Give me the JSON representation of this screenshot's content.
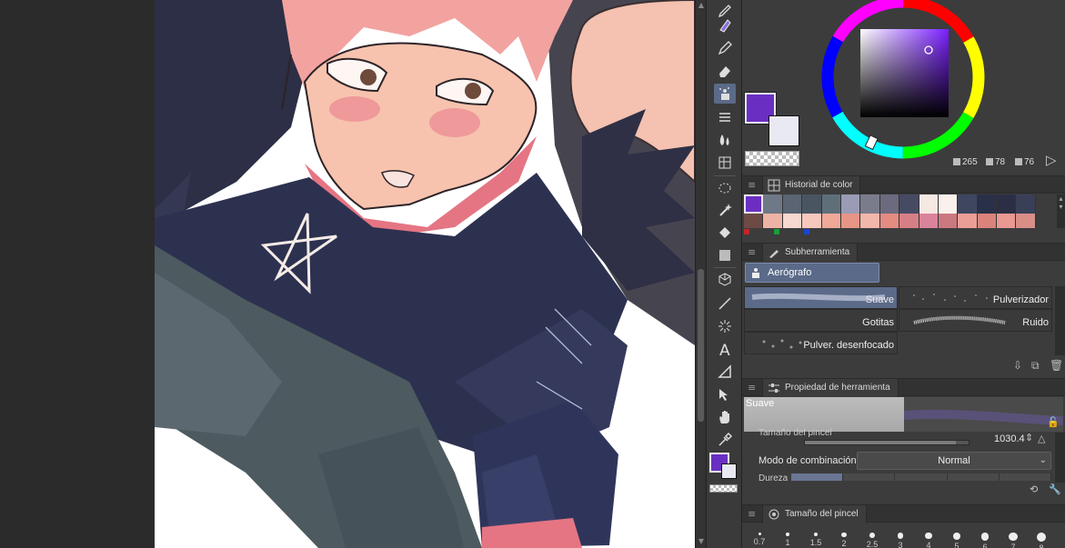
{
  "color": {
    "main_color": "#6a2fc2",
    "sub_color": "#e9e9f4",
    "h": "265",
    "s": "78",
    "v": "76",
    "h_icon": "hue-icon",
    "s_icon": "saturation-icon",
    "v_icon": "value-icon"
  },
  "panels": {
    "history_title": "Historial de color",
    "subtool_title": "Subherramienta",
    "property_title": "Propiedad de herramienta",
    "brushsize_title": "Tamaño del pincel"
  },
  "history": {
    "row1": [
      "#6a2fc2",
      "#6f7886",
      "#5a6472",
      "#4a5562",
      "#5f6f7a",
      "#9a9cb6",
      "#7a7c8c",
      "#6b6a7e",
      "#474a63",
      "#f6e8e2",
      "#fbf1ec",
      "#3e4660",
      "#2a3048",
      "#2b2e44",
      "#3a3f58"
    ],
    "row2": [
      "#6e4a45",
      "#eeb3a4",
      "#f7d8d0",
      "#f6c8bd",
      "#f0a898",
      "#e79587",
      "#f2b7aa",
      "#e48b82",
      "#d77f86",
      "#d9849a",
      "#cc7880",
      "#eb9e96",
      "#d9837a",
      "#e99892",
      "#d98e88"
    ],
    "dots": [
      "#c0262a",
      "#1a9c3a",
      "#1c44d0"
    ]
  },
  "subtool": {
    "group_label": "Aerógrafo",
    "brushes": [
      "Suave",
      "Pulverizador",
      "Gotitas",
      "Ruido",
      "Pulver. desenfocado"
    ]
  },
  "property": {
    "preview_label": "Suave",
    "size_label": "Tamaño del pincel",
    "size_value": "1030.4",
    "blend_label": "Modo de combinación",
    "blend_value": "Normal",
    "density_label": "Dureza"
  },
  "brush_sizes": [
    "0.7",
    "1",
    "1.5",
    "2",
    "2.5",
    "3",
    "4",
    "5",
    "6",
    "7",
    "8"
  ]
}
